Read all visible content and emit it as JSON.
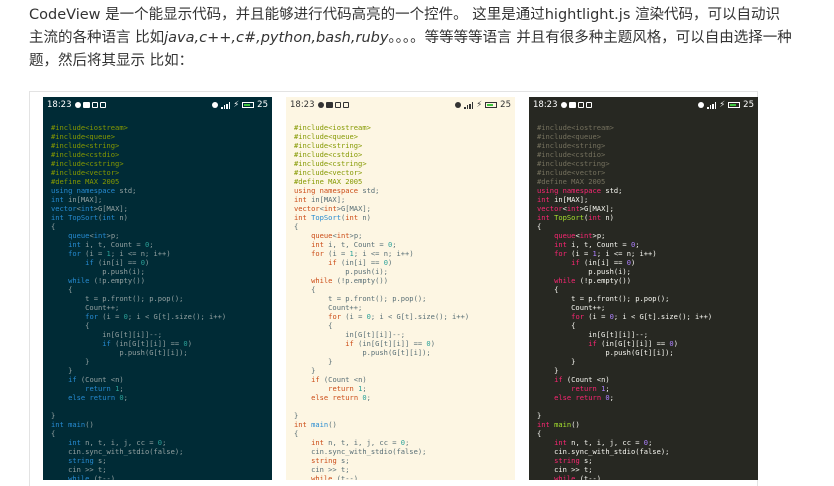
{
  "intro": {
    "line1": "CodeView 是一个能显示代码，并且能够进行代码高亮的一个控件。 这里是通过hightlight.js 渲染代码，可以自动识",
    "line2_pre": "主流的各种语言 比如",
    "line2_em": "java,c++,c#,python,bash,ruby",
    "line2_post": "。。。。等等等等语言 并且有很多种主题风格，可以自由选择一种",
    "line3": "题，然后将其显示 比如："
  },
  "statusbar": {
    "time": "18:23",
    "battery": "25"
  },
  "code_lines": [
    "#include<iostream>",
    "#include<queue>",
    "#include<string>",
    "#include<cstdio>",
    "#include<cstring>",
    "#include<vector>",
    "#define MAX 2005",
    "using namespace std;",
    "int in[MAX];",
    "vector<int>G[MAX];",
    "int TopSort(int n)",
    "{",
    "    queue<int>p;",
    "    int i, t, Count = 0;",
    "    for (i = 1; i <= n; i++)",
    "        if (in[i] == 0)",
    "            p.push(i);",
    "    while (!p.empty())",
    "    {",
    "        t = p.front(); p.pop();",
    "        Count++;",
    "        for (i = 0; i < G[t].size(); i++)",
    "        {",
    "            in[G[t][i]]--;",
    "            if (in[G[t][i]] == 0)",
    "                p.push(G[t][i]);",
    "        }",
    "    }",
    "    if (Count <n)",
    "        return 1;",
    "    else return 0;",
    "",
    "}",
    "int main()",
    "{",
    "    int n, t, i, j, cc = 0;",
    "    cin.sync_with_stdio(false);",
    "    string s;",
    "    cin >> t;",
    "    while (t--)"
  ],
  "themes": [
    {
      "name": "dark-teal",
      "background": "#002b36"
    },
    {
      "name": "solarized-light",
      "background": "#fdf6e3"
    },
    {
      "name": "monokai",
      "background": "#272822"
    }
  ]
}
